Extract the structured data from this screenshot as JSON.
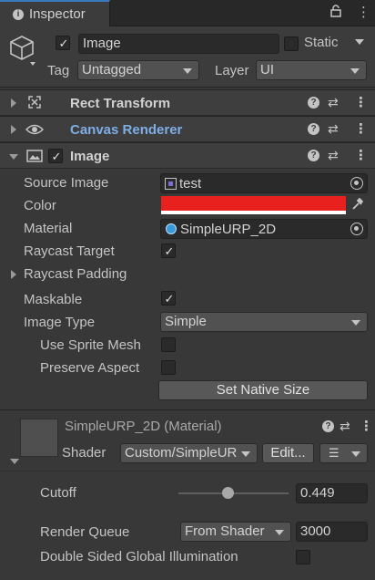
{
  "tab": {
    "title": "Inspector",
    "info_icon": "info-icon",
    "lock_icon": "lock-icon",
    "menu_icon": "more-vertical-icon"
  },
  "header": {
    "object_name": "Image",
    "static_label": "Static",
    "tag_label": "Tag",
    "tag_value": "Untagged",
    "layer_label": "Layer",
    "layer_value": "UI"
  },
  "components": [
    {
      "title": "Rect Transform",
      "icon": "rect-transform-icon"
    },
    {
      "title": "Canvas Renderer",
      "icon": "eye-icon"
    },
    {
      "title": "Image",
      "icon": "image-icon"
    }
  ],
  "image": {
    "source_image_label": "Source Image",
    "source_image_value": "test",
    "color_label": "Color",
    "color_value": "#e8211f",
    "material_label": "Material",
    "material_value": "SimpleURP_2D",
    "raycast_target_label": "Raycast Target",
    "raycast_padding_label": "Raycast Padding",
    "maskable_label": "Maskable",
    "image_type_label": "Image Type",
    "image_type_value": "Simple",
    "use_sprite_mesh_label": "Use Sprite Mesh",
    "preserve_aspect_label": "Preserve Aspect",
    "set_native_size_label": "Set Native Size"
  },
  "material": {
    "title": "SimpleURP_2D (Material)",
    "shader_label": "Shader",
    "shader_value": "Custom/SimpleUR",
    "edit_label": "Edit...",
    "cutoff_label": "Cutoff",
    "cutoff_value": "0.449",
    "cutoff_fraction": 0.449,
    "render_queue_label": "Render Queue",
    "render_queue_mode": "From Shader",
    "render_queue_value": "3000",
    "double_sided_label": "Double Sided Global Illumination"
  }
}
